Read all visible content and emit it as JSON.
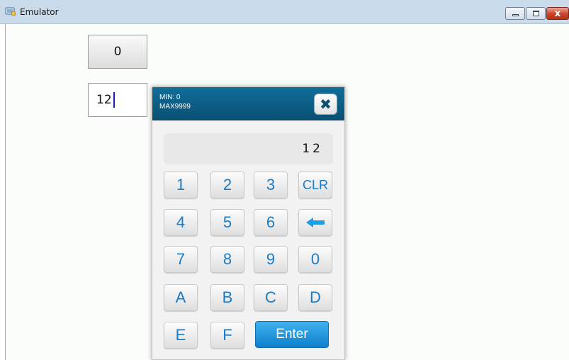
{
  "window": {
    "title": "Emulator",
    "minimize_icon": "minimize-icon",
    "maximize_icon": "maximize-icon",
    "close_glyph": "x",
    "close_color": "#c9442a"
  },
  "fields": {
    "first_value": "0",
    "second_value": "12"
  },
  "keypad": {
    "min_label": "MIN: 0",
    "max_label": "MAX9999",
    "close_glyph": "✖",
    "display_value": "12",
    "header_color": "#0a5a80",
    "key_text_color": "#1b7bc6",
    "keys": {
      "k1": "1",
      "k2": "2",
      "k3": "3",
      "clr": "CLR",
      "k4": "4",
      "k5": "5",
      "k6": "6",
      "backspace_icon": "backspace-arrow-icon",
      "k7": "7",
      "k8": "8",
      "k9": "9",
      "k0": "0",
      "ka": "A",
      "kb": "B",
      "kc": "C",
      "kd": "D",
      "ke": "E",
      "kf": "F",
      "enter": "Enter"
    }
  }
}
